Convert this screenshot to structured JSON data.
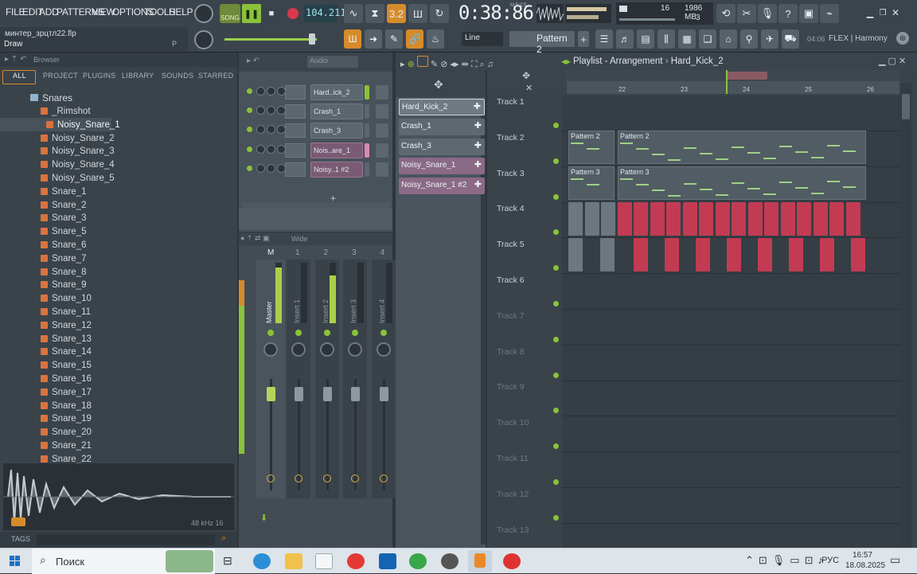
{
  "menu": [
    "FILE",
    "EDIT",
    "ADD",
    "PATTERNS",
    "VIEW",
    "OPTIONS",
    "TOOLS",
    "HELP"
  ],
  "transport": {
    "song_label": "SONG",
    "tempo": "104.211",
    "time": "0:38:86",
    "time_unit": "M:S:CS",
    "polyphony": "16",
    "voices": "3",
    "memory": "1986 MB"
  },
  "project": {
    "file": "минтер_зрцтл22.flp",
    "hint_left": "Draw",
    "hint_right": "P"
  },
  "toolbar": {
    "snap": "Line",
    "pattern": "Pattern 2",
    "version": "04:06",
    "flex_label": "FLEX | Harmony"
  },
  "browser": {
    "title": "Browser",
    "tabs": [
      "ALL",
      "PROJECT",
      "PLUGINS",
      "LIBRARY",
      "SOUNDS",
      "STARRED"
    ],
    "folder": "Snares",
    "items": [
      "_Rimshot",
      "Noisy_Snare_1",
      "Noisy_Snare_2",
      "Noisy_Snare_3",
      "Noisy_Snare_4",
      "Noisy_Snare_5",
      "Snare_1",
      "Snare_2",
      "Snare_3",
      "Snare_5",
      "Snare_6",
      "Snare_7",
      "Snare_8",
      "Snare_9",
      "Snare_10",
      "Snare_11",
      "Snare_12",
      "Snare_13",
      "Snare_14",
      "Snare_15",
      "Snare_16",
      "Snare_17",
      "Snare_18",
      "Snare_19",
      "Snare_20",
      "Snare_21",
      "Snare_22"
    ],
    "selected": "Noisy_Snare_1",
    "sample_info": "48 kHz 16",
    "tags_label": "TAGS"
  },
  "channel_rack": {
    "group": "Audio",
    "channels": [
      "Hard..ick_2",
      "Crash_1",
      "Crash_3",
      "Nois..are_1",
      "Noisy..1 #2"
    ]
  },
  "mixer": {
    "view": "Wide",
    "strips": [
      "M",
      "1",
      "2",
      "3",
      "4"
    ],
    "labels": [
      "Master",
      "Insert 1",
      "Insert 2",
      "Insert 3",
      "Insert 4"
    ]
  },
  "picker": {
    "clips": [
      "Hard_Kick_2",
      "Crash_1",
      "Crash_3",
      "Noisy_Snare_1",
      "Noisy_Snare_1 #2"
    ]
  },
  "playlist": {
    "title": "Playlist - Arrangement",
    "breadcrumb": "Hard_Kick_2",
    "bars": [
      "22",
      "23",
      "24",
      "25",
      "26"
    ],
    "tracks": [
      "Track 1",
      "Track 2",
      "Track 3",
      "Track 4",
      "Track 5",
      "Track 6",
      "Track 7",
      "Track 8",
      "Track 9",
      "Track 10",
      "Track 11",
      "Track 12",
      "Track 13"
    ],
    "pattern_clips": [
      "Pattern 2",
      "Pattern 2",
      "Pattern 3",
      "Pattern 3"
    ]
  },
  "taskbar": {
    "search": "Поиск",
    "lang": "РУС",
    "time": "16:57",
    "date": "18.08.2025"
  }
}
